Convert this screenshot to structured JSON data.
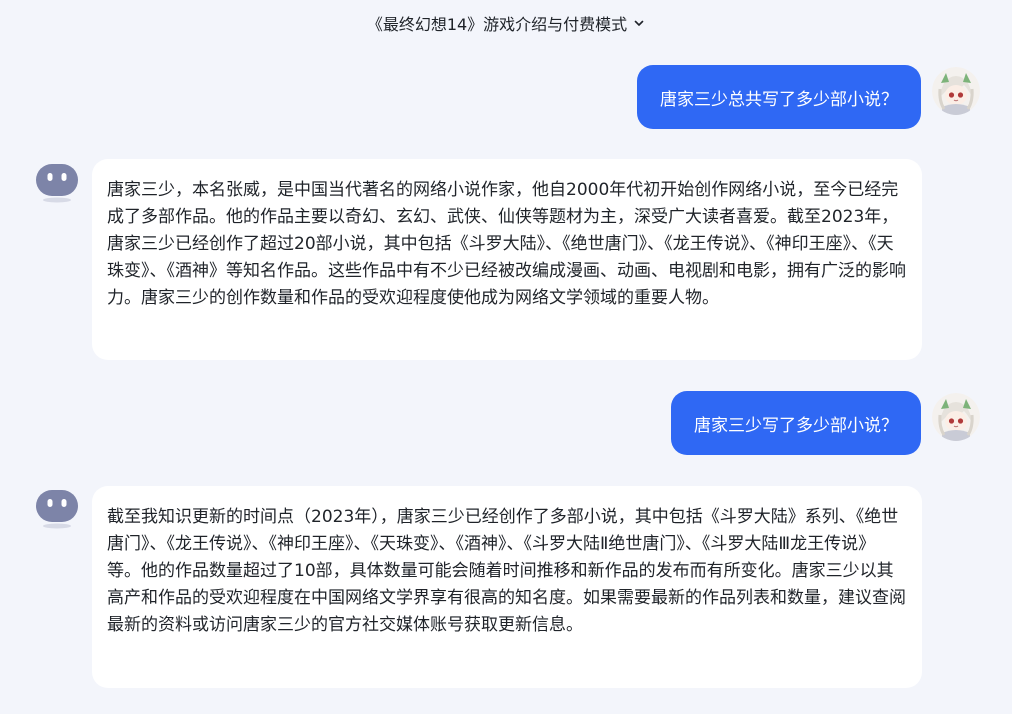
{
  "header": {
    "title": "《最终幻想14》游戏介绍与付费模式"
  },
  "conversation": [
    {
      "role": "user",
      "text": "唐家三少总共写了多少部小说？"
    },
    {
      "role": "assistant",
      "text": "唐家三少，本名张威，是中国当代著名的网络小说作家，他自2000年代初开始创作网络小说，至今已经完成了多部作品。他的作品主要以奇幻、玄幻、武侠、仙侠等题材为主，深受广大读者喜爱。截至2023年，唐家三少已经创作了超过20部小说，其中包括《斗罗大陆》、《绝世唐门》、《龙王传说》、《神印王座》、《天珠变》、《酒神》等知名作品。这些作品中有不少已经被改编成漫画、动画、电视剧和电影，拥有广泛的影响力。唐家三少的创作数量和作品的受欢迎程度使他成为网络文学领域的重要人物。"
    },
    {
      "role": "user",
      "text": "唐家三少写了多少部小说？"
    },
    {
      "role": "assistant",
      "text": "截至我知识更新的时间点（2023年），唐家三少已经创作了多部小说，其中包括《斗罗大陆》系列、《绝世唐门》、《龙王传说》、《神印王座》、《天珠变》、《酒神》、《斗罗大陆Ⅱ绝世唐门》、《斗罗大陆Ⅲ龙王传说》等。他的作品数量超过了10部，具体数量可能会随着时间推移和新作品的发布而有所变化。唐家三少以其高产和作品的受欢迎程度在中国网络文学界享有很高的知名度。如果需要最新的作品列表和数量，建议查阅最新的资料或访问唐家三少的官方社交媒体账号获取更新信息。"
    }
  ],
  "icons": {
    "title_menu": "chevron-down-icon",
    "user_avatar": "anime-girl-avatar",
    "assistant_avatar": "robot-face-avatar"
  },
  "colors": {
    "page_background": "#f3f5fb",
    "user_bubble": "#2f68f4",
    "assistant_bubble": "#ffffff",
    "bot_avatar": "#7d84a8"
  }
}
